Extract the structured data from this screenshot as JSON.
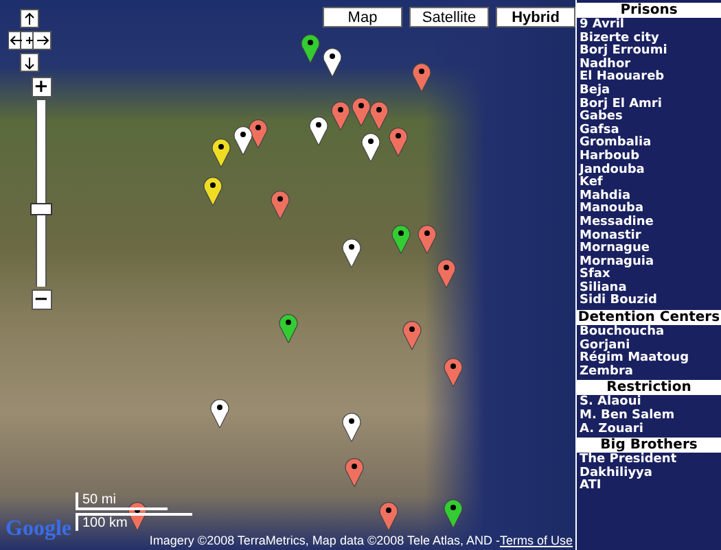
{
  "map": {
    "map_types": [
      {
        "label": "Map",
        "selected": false
      },
      {
        "label": "Satellite",
        "selected": false
      },
      {
        "label": "Hybrid",
        "selected": true
      }
    ],
    "zoom": {
      "plus": "+",
      "minus": "−",
      "level": 0.42
    },
    "pins": [
      {
        "color": "#33cc33"
      },
      {
        "color": "#ffffff"
      },
      {
        "color": "#f07060"
      },
      {
        "color": "#f07060"
      },
      {
        "color": "#f07060"
      },
      {
        "color": "#f07060"
      },
      {
        "color": "#ffffff"
      },
      {
        "color": "#ffffff"
      },
      {
        "color": "#f07060"
      },
      {
        "color": "#f07060"
      },
      {
        "color": "#ffffff"
      },
      {
        "color": "#eedd22"
      },
      {
        "color": "#eedd22"
      },
      {
        "color": "#f07060"
      },
      {
        "color": "#33cc33"
      },
      {
        "color": "#f07060"
      },
      {
        "color": "#ffffff"
      },
      {
        "color": "#f07060"
      },
      {
        "color": "#33cc33"
      },
      {
        "color": "#f07060"
      },
      {
        "color": "#f07060"
      },
      {
        "color": "#ffffff"
      },
      {
        "color": "#ffffff"
      },
      {
        "color": "#f07060"
      },
      {
        "color": "#f07060"
      },
      {
        "color": "#33cc33"
      },
      {
        "color": "#f07060"
      }
    ],
    "logo": "Google",
    "scale": {
      "imperial": "50 mi",
      "metric": "100 km"
    },
    "attribution": "Imagery ©2008 TerraMetrics, Map data ©2008 Tele Atlas, AND - ",
    "terms_link": "Terms of Use"
  },
  "sidebar": {
    "sections": [
      {
        "heading": "Prisons",
        "items": [
          "9 Avril",
          "Bizerte city",
          "Borj Erroumi",
          "Nadhor",
          "El Haouareb",
          "Beja",
          "Borj El Amri",
          "Gabes",
          "Gafsa",
          "Grombalia",
          "Harboub",
          "Jandouba",
          "Kef",
          "Mahdia",
          "Manouba",
          "Messadine",
          "Monastir",
          "Mornague",
          "Mornaguia",
          "Sfax",
          "Siliana",
          "Sidi Bouzid"
        ]
      },
      {
        "heading": "Detention Centers",
        "items": [
          "Bouchoucha",
          "Gorjani",
          "Régim Maatoug",
          "Zembra"
        ]
      },
      {
        "heading": "Restriction",
        "items": [
          "S. Alaoui",
          "M. Ben Salem",
          "A. Zouari"
        ]
      },
      {
        "heading": "Big Brothers",
        "items": [
          "The President",
          "Dakhiliyya",
          "ATI"
        ]
      }
    ]
  }
}
